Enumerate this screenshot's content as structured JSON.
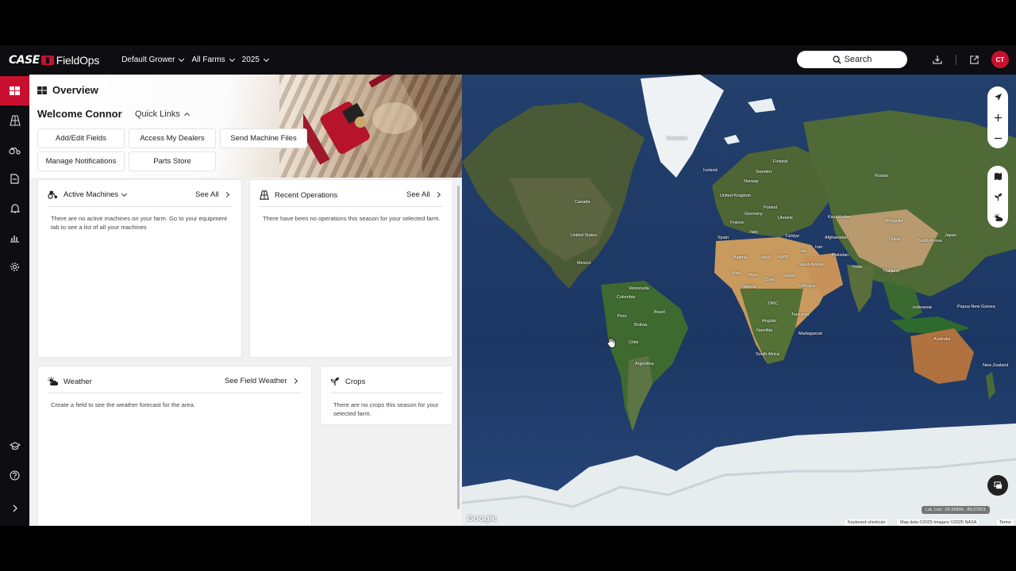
{
  "brand": {
    "case": "CASE",
    "app": "FieldOps"
  },
  "header": {
    "grower": "Default Grower",
    "farms": "All Farms",
    "year": "2025",
    "search_label": "Search",
    "avatar_initials": "CT",
    "accent_color": "#c8102e"
  },
  "rail": {
    "items": [
      "overview-icon",
      "fields-icon",
      "equipment-icon",
      "operations-icon",
      "notifications-icon",
      "reports-icon",
      "settings-icon"
    ],
    "bottom": [
      "learning-icon",
      "help-icon",
      "expand-icon"
    ]
  },
  "overview": {
    "title": "Overview",
    "welcome": "Welcome Connor",
    "quick_links_label": "Quick Links",
    "quick_links": {
      "add_edit_fields": "Add/Edit Fields",
      "access_dealers": "Access My Dealers",
      "send_machine_files": "Send Machine Files",
      "manage_notifications": "Manage Notifications",
      "parts_store": "Parts Store"
    },
    "active_machines": {
      "title": "Active Machines",
      "see_all": "See All",
      "empty_text": "There are no active machines on your farm. Go to your equipment tab to see a list of all your machines"
    },
    "recent_operations": {
      "title": "Recent Operations",
      "see_all": "See All",
      "empty_text": "There have been no operations this season for your selected farm."
    },
    "weather": {
      "title": "Weather",
      "see_field_weather": "See Field Weather",
      "empty_text": "Create a field to see the weather forecast for the area."
    },
    "crops": {
      "title": "Crops",
      "empty_text": "There are no crops this season for your selected farm."
    }
  },
  "map": {
    "labels": {
      "greenland": "Greenland",
      "iceland": "Iceland",
      "canada": "Canada",
      "united_states": "United States",
      "mexico": "Mexico",
      "venezuela": "Venezuela",
      "colombia": "Colombia",
      "peru": "Peru",
      "brazil": "Brazil",
      "bolivia": "Bolivia",
      "chile": "Chile",
      "argentina": "Argentina",
      "sweden": "Sweden",
      "finland": "Finland",
      "norway": "Norway",
      "united_kingdom": "United Kingdom",
      "germany": "Germany",
      "poland": "Poland",
      "ukraine": "Ukraine",
      "france": "France",
      "spain": "Spain",
      "italy": "Italy",
      "turkiye": "Türkiye",
      "russia": "Russia",
      "kazakhstan": "Kazakhstan",
      "mongolia": "Mongolia",
      "china": "China",
      "japan": "Japan",
      "south_korea": "South Korea",
      "iran": "Iran",
      "afghanistan": "Afghanistan",
      "pakistan": "Pakistan",
      "india": "India",
      "saudi_arabia": "Saudi Arabia",
      "iraq": "Iraq",
      "egypt": "Egypt",
      "libya": "Libya",
      "algeria": "Algeria",
      "mali": "Mali",
      "niger": "Niger",
      "chad": "Chad",
      "sudan": "Sudan",
      "ethiopia": "Ethiopia",
      "nigeria": "Nigeria",
      "drc": "DRC",
      "tanzania": "Tanzania",
      "angola": "Angola",
      "namibia": "Namibia",
      "south_africa": "South Africa",
      "madagascar": "Madagascar",
      "thailand": "Thailand",
      "indonesia": "Indonesia",
      "papua_new_guinea": "Papua New Guinea",
      "australia": "Australia",
      "new_zealand": "New Zealand"
    },
    "coords_text": "Lat, Lon: -25.95804, -85.07813",
    "google": "Google",
    "keyboard_shortcuts": "Keyboard shortcuts",
    "map_data": "Map data ©2025 Imagery ©2025 NASA",
    "terms": "Terms"
  }
}
